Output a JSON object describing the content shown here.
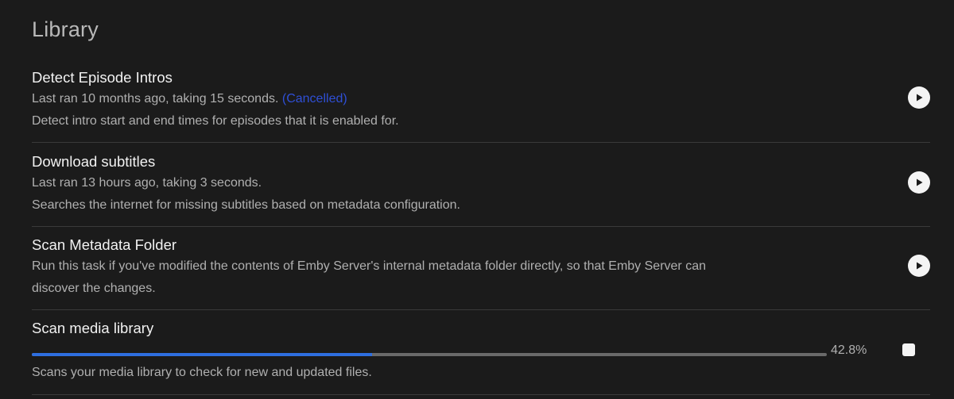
{
  "section": {
    "title": "Library"
  },
  "tasks": [
    {
      "name": "Detect Episode Intros",
      "last_run": "Last ran 10 months ago, taking 15 seconds.",
      "status": "(Cancelled)",
      "description": "Detect intro start and end times for episodes that it is enabled for."
    },
    {
      "name": "Download subtitles",
      "last_run": "Last ran 13 hours ago, taking 3 seconds.",
      "description": "Searches the internet for missing subtitles based on metadata configuration."
    },
    {
      "name": "Scan Metadata Folder",
      "description_line1": "Run this task if you've modified the contents of Emby Server's internal metadata folder directly, so that Emby Server can",
      "description_line2": "discover the changes."
    },
    {
      "name": "Scan media library",
      "progress_percent": 42.8,
      "progress_label": "42.8%",
      "description": "Scans your media library to check for new and updated files."
    }
  ],
  "icons": {
    "play": "play-icon",
    "stop": "stop-icon"
  },
  "colors": {
    "accent": "#2e6fe0",
    "cancelled": "#2f4fd6",
    "background": "#1b1b1b"
  }
}
